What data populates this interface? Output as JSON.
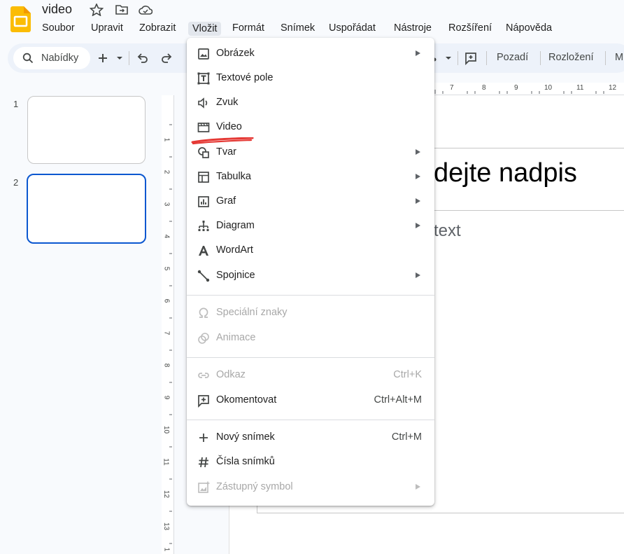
{
  "document": {
    "title": "video"
  },
  "menubar": {
    "items": [
      "Soubor",
      "Upravit",
      "Zobrazit",
      "Vložit",
      "Formát",
      "Snímek",
      "Uspořádat",
      "Nástroje",
      "Rozšíření",
      "Nápověda"
    ],
    "active": "Vložit"
  },
  "toolbar": {
    "search_placeholder": "Nabídky",
    "background_label": "Pozadí",
    "layout_label": "Rozložení",
    "cut_off_label": "M"
  },
  "filmstrip": {
    "slides": [
      "1",
      "2"
    ],
    "selected": "2"
  },
  "rulers": {
    "horizontal": [
      "7",
      "8",
      "9",
      "10",
      "11",
      "12"
    ],
    "vertical": [
      "1",
      "2",
      "3",
      "4",
      "5",
      "6",
      "7",
      "8",
      "9",
      "10",
      "11",
      "12",
      "13",
      "1"
    ]
  },
  "slide": {
    "title_visible": "dejte nadpis",
    "body_visible": "text"
  },
  "insert_menu": {
    "items": [
      {
        "label": "Obrázek",
        "icon": "image-icon",
        "submenu": true
      },
      {
        "label": "Textové pole",
        "icon": "text-box-icon"
      },
      {
        "label": "Zvuk",
        "icon": "audio-icon"
      },
      {
        "label": "Video",
        "icon": "video-icon"
      },
      {
        "label": "Tvar",
        "icon": "shape-icon",
        "submenu": true
      },
      {
        "label": "Tabulka",
        "icon": "table-icon",
        "submenu": true
      },
      {
        "label": "Graf",
        "icon": "chart-icon",
        "submenu": true
      },
      {
        "label": "Diagram",
        "icon": "diagram-icon",
        "submenu": true
      },
      {
        "label": "WordArt",
        "icon": "wordart-icon"
      },
      {
        "label": "Spojnice",
        "icon": "line-icon",
        "submenu": true
      },
      {
        "label": "Speciální znaky",
        "icon": "omega-icon",
        "disabled": true
      },
      {
        "label": "Animace",
        "icon": "animation-icon",
        "disabled": true
      },
      {
        "label": "Odkaz",
        "icon": "link-icon",
        "shortcut": "Ctrl+K",
        "disabled": true
      },
      {
        "label": "Okomentovat",
        "icon": "comment-icon",
        "shortcut": "Ctrl+Alt+M"
      },
      {
        "label": "Nový snímek",
        "icon": "plus-icon",
        "shortcut": "Ctrl+M"
      },
      {
        "label": "Čísla snímků",
        "icon": "hash-icon"
      },
      {
        "label": "Zástupný symbol",
        "icon": "placeholder-icon",
        "submenu": true,
        "disabled": true
      }
    ],
    "highlighted": "Video",
    "annotation_color": "#e53935"
  },
  "colors": {
    "accent": "#0b57d0",
    "app_logo": "#fbbc04"
  }
}
